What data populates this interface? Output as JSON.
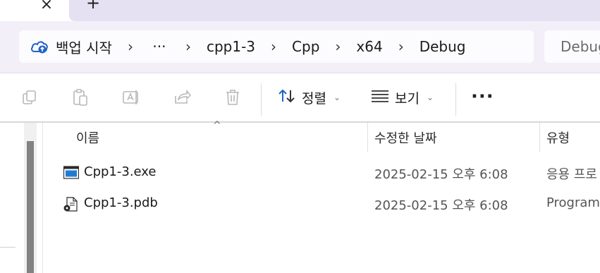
{
  "tabs": {
    "close_glyph": "×",
    "new_tab_glyph": "+"
  },
  "address": {
    "home_label": "백업 시작",
    "overflow": "···",
    "crumbs": [
      "cpp1-3",
      "Cpp",
      "x64",
      "Debug"
    ],
    "separator": "›",
    "search_placeholder": "Debug"
  },
  "toolbar": {
    "sort_label": "정렬",
    "view_label": "보기",
    "more_label": "···",
    "icons": [
      "copy-icon",
      "paste-icon",
      "rename-icon",
      "share-icon",
      "delete-icon",
      "sort-icon",
      "view-icon",
      "more-icon"
    ]
  },
  "list": {
    "columns": {
      "name": "이름",
      "date": "수정한 날짜",
      "type": "유형"
    },
    "sort_caret": "^",
    "rows": [
      {
        "name": "Cpp1-3.exe",
        "date": "2025-02-15 오후 6:08",
        "type": "응용 프로",
        "icon": "exe-icon"
      },
      {
        "name": "Cpp1-3.pdb",
        "date": "2025-02-15 오후 6:08",
        "type": "Program D",
        "icon": "pdb-icon"
      }
    ]
  },
  "colors": {
    "accent": "#1f63c6",
    "chrome": "#f3eff9",
    "tab_bg": "#e6e0f3"
  }
}
